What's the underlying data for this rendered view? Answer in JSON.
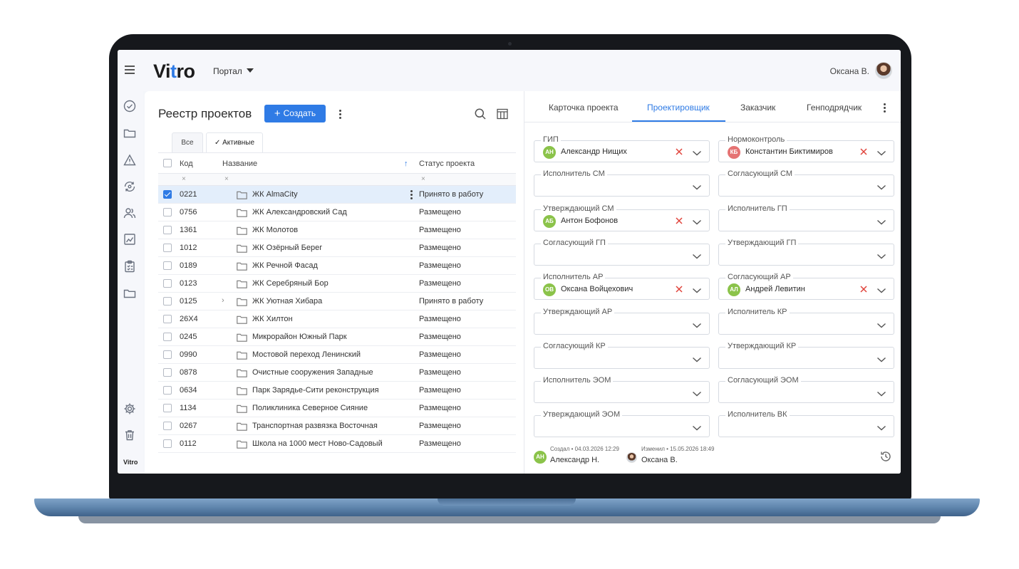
{
  "header": {
    "logo_start": "Vi",
    "logo_accent": "t",
    "logo_end": "ro",
    "portal_label": "Портал",
    "user_name": "Оксана В."
  },
  "sidebar": {
    "footer_logo": "Vitro",
    "icons": [
      "check-circle-icon",
      "folder-icon",
      "warning-icon",
      "refresh-eye-icon",
      "users-icon",
      "chart-icon",
      "clipboard-icon",
      "folder-icon",
      "gear-icon",
      "trash-icon"
    ]
  },
  "registry": {
    "title": "Реестр проектов",
    "create_label": "Создать",
    "tabs": [
      "Все",
      "Активные"
    ],
    "columns": {
      "code": "Код",
      "name": "Название",
      "status": "Статус проекта"
    },
    "rows": [
      {
        "code": "0221",
        "name": "ЖК AlmaCity",
        "status": "Принято в работу",
        "selected": true
      },
      {
        "code": "0756",
        "name": "ЖК Александровский Сад",
        "status": "Размещено"
      },
      {
        "code": "1361",
        "name": "ЖК Молотов",
        "status": "Размещено"
      },
      {
        "code": "1012",
        "name": "ЖК Озёрный Берег",
        "status": "Размещено"
      },
      {
        "code": "0189",
        "name": "ЖК Речной Фасад",
        "status": "Размещено"
      },
      {
        "code": "0123",
        "name": "ЖК Серебряный Бор",
        "status": "Размещено"
      },
      {
        "code": "0125",
        "name": "ЖК Уютная Хибара",
        "status": "Принято в работу",
        "expandable": true
      },
      {
        "code": "26X4",
        "name": "ЖК Хилтон",
        "status": "Размещено"
      },
      {
        "code": "0245",
        "name": "Микрорайон Южный Парк",
        "status": "Размещено"
      },
      {
        "code": "0990",
        "name": "Мостовой переход Ленинский",
        "status": "Размещено"
      },
      {
        "code": "0878",
        "name": "Очистные сооружения Западные",
        "status": "Размещено"
      },
      {
        "code": "0634",
        "name": "Парк Зарядье-Сити реконструкция",
        "status": "Размещено"
      },
      {
        "code": "1134",
        "name": "Поликлиника Северное Сияние",
        "status": "Размещено"
      },
      {
        "code": "0267",
        "name": "Транспортная развязка Восточная",
        "status": "Размещено"
      },
      {
        "code": "0112",
        "name": "Школа на 1000 мест Ново-Садовый",
        "status": "Размещено"
      }
    ]
  },
  "details": {
    "tabs": [
      "Карточка проекта",
      "Проектировщик",
      "Заказчик",
      "Генподрядчик"
    ],
    "active_tab": "Проектировщик",
    "fields": [
      {
        "label": "ГИП",
        "value": "Александр Нищих",
        "initials": "АН",
        "color": "#8bc34a"
      },
      {
        "label": "Нормоконтроль",
        "value": "Константин Биктимиров",
        "initials": "КБ",
        "color": "#e57373"
      },
      {
        "label": "Исполнитель СМ",
        "value": ""
      },
      {
        "label": "Согласующий СМ",
        "value": ""
      },
      {
        "label": "Утверждающий СМ",
        "value": "Антон Бофонов",
        "initials": "АБ",
        "color": "#8bc34a"
      },
      {
        "label": "Исполнитель ГП",
        "value": ""
      },
      {
        "label": "Согласующий ГП",
        "value": ""
      },
      {
        "label": "Утверждающий ГП",
        "value": ""
      },
      {
        "label": "Исполнитель АР",
        "value": "Оксана Войцехович",
        "initials": "ОВ",
        "color": "#8bc34a"
      },
      {
        "label": "Согласующий АР",
        "value": "Андрей Левитин",
        "initials": "АЛ",
        "color": "#8bc34a"
      },
      {
        "label": "Утверждающий АР",
        "value": ""
      },
      {
        "label": "Исполнитель КР",
        "value": ""
      },
      {
        "label": "Согласующий КР",
        "value": ""
      },
      {
        "label": "Утверждающий КР",
        "value": ""
      },
      {
        "label": "Исполнитель ЭОМ",
        "value": ""
      },
      {
        "label": "Согласующий ЭОМ",
        "value": ""
      },
      {
        "label": "Утверждающий ЭОМ",
        "value": ""
      },
      {
        "label": "Исполнитель ВК",
        "value": ""
      }
    ],
    "created": {
      "meta": "Создал • 04.03.2026 12:29",
      "name": "Александр Н.",
      "initials": "АН"
    },
    "modified": {
      "meta": "Изменил • 15.05.2026 18:49",
      "name": "Оксана В."
    }
  },
  "colors": {
    "accent": "#2f7be5",
    "avatar_green": "#8bc34a",
    "avatar_red": "#e57373",
    "remove": "#e0433b"
  }
}
